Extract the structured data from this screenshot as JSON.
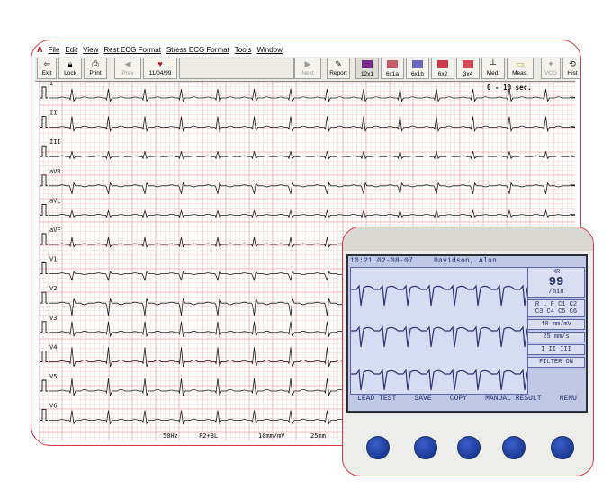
{
  "menu": [
    "File",
    "Edit",
    "View",
    "Rest ECG Format",
    "Stress ECG Format",
    "Tools",
    "Window"
  ],
  "toolbar": {
    "exit": "Exit",
    "lock": "Lock",
    "print": "Print",
    "prev": "Prev",
    "date": "11/04/99",
    "next": "Next",
    "report": "Report",
    "formats": [
      {
        "label": "12x1",
        "color": "#7a2a8a"
      },
      {
        "label": "6x1a",
        "color": "#c85a6a"
      },
      {
        "label": "6x1b",
        "color": "#6a66c2"
      },
      {
        "label": "6x2",
        "color": "#cc3a4a"
      },
      {
        "label": "3x4",
        "color": "#d2495a"
      }
    ],
    "med": "Med.",
    "meas": "Meas.",
    "vcg": "VCG",
    "hist": "Hist"
  },
  "ecg": {
    "leads": [
      "I",
      "II",
      "III",
      "aVR",
      "aVL",
      "aVF",
      "V1",
      "V2",
      "V3",
      "V4",
      "V5",
      "V6"
    ],
    "time_range": "0 - 10 sec.",
    "footer": {
      "filter": "50Hz",
      "mode": "F2+BL",
      "gain": "10mm/mV",
      "speed": "25mm"
    }
  },
  "device": {
    "time": "10:21 02-08-07",
    "patient": "Davidson, Alan",
    "hr_label": "HR",
    "hr_value": "99",
    "hr_unit": "/min",
    "leads_row1": "R L F C1 C2",
    "leads_row2": "C3 C4 C5 C6",
    "gain": "10 mm/mV",
    "speed": "25 mm/s",
    "lead_set": "I  II  III",
    "filter": "FILTER  ON",
    "softkeys": [
      "LEAD TEST",
      "SAVE",
      "COPY",
      "MANUAL RESULT",
      "MENU"
    ]
  },
  "colors": {
    "frame": "#d9363e",
    "grid_minor": "#f6d3d3",
    "grid_major": "#eba7a7",
    "trace": "#1a1a1a",
    "screen": "#bfc9e6"
  }
}
